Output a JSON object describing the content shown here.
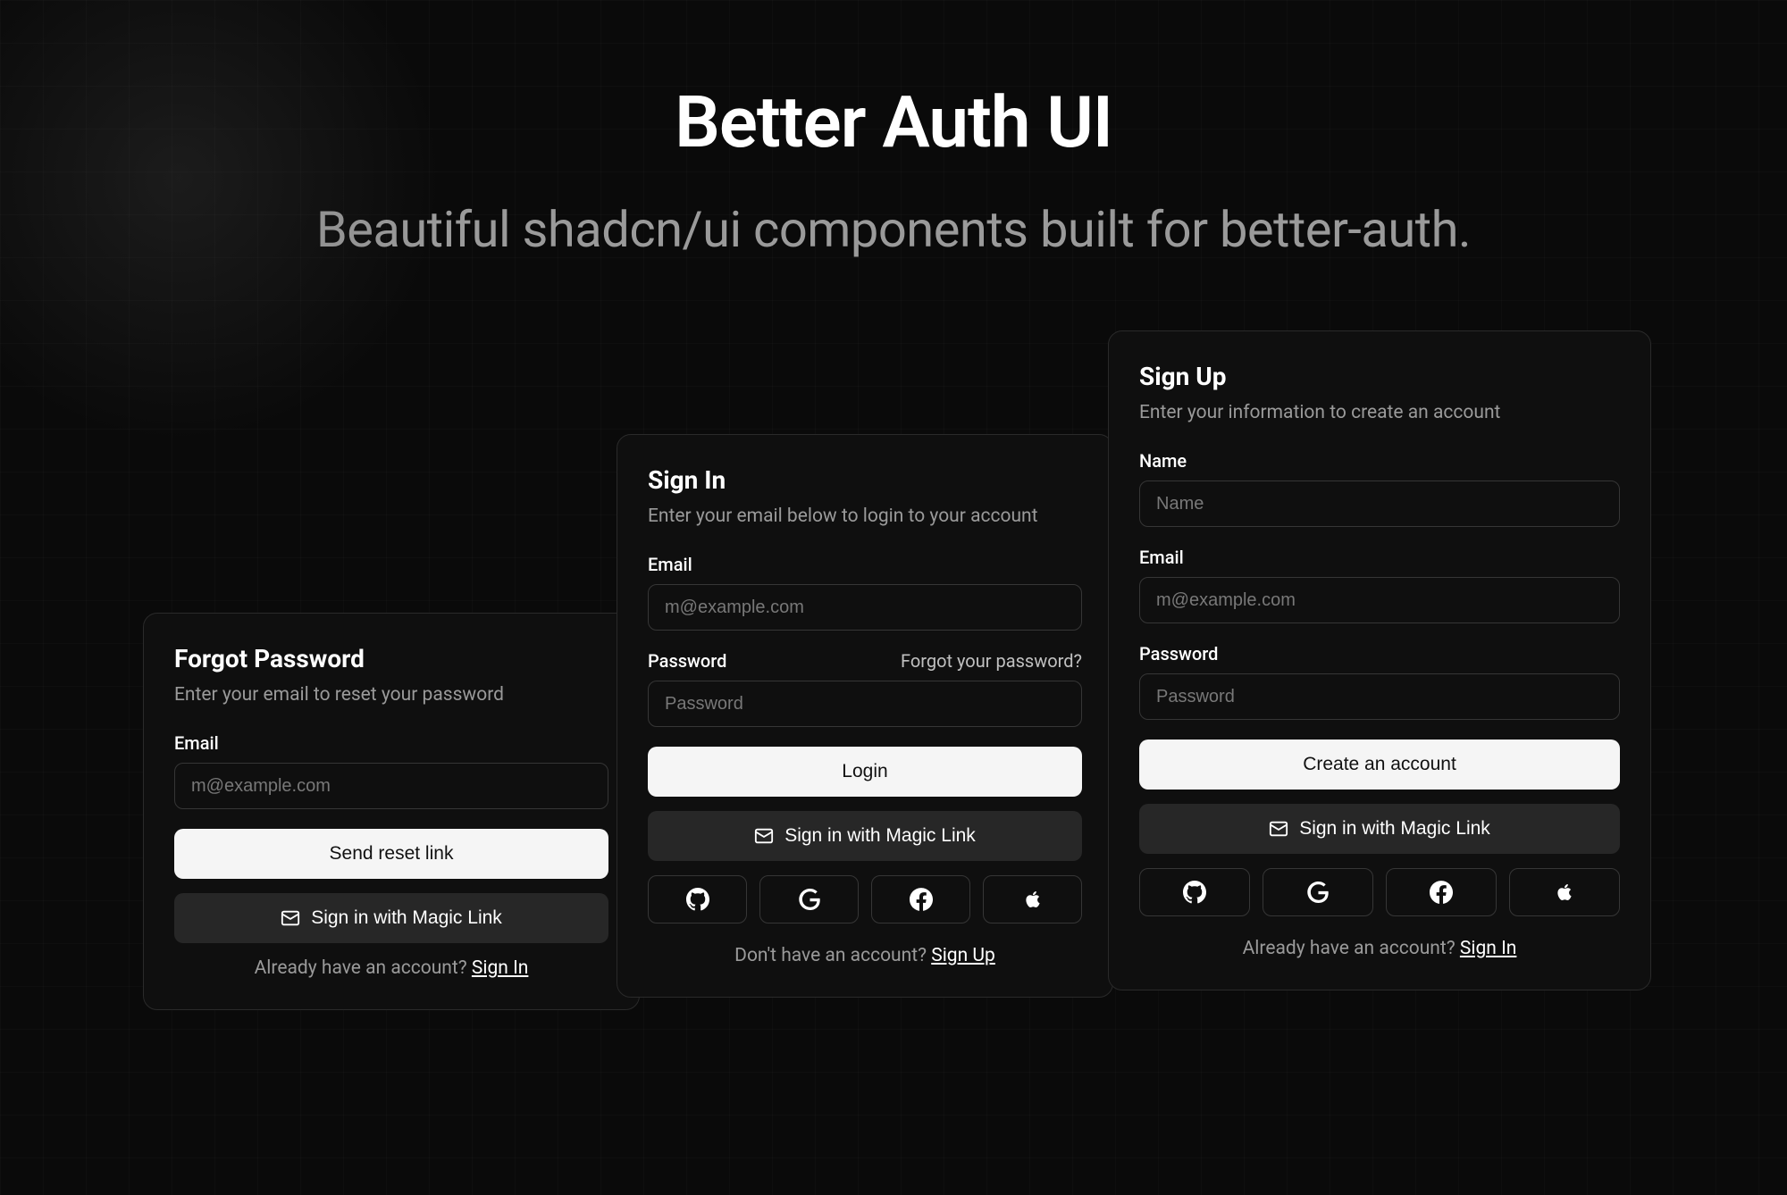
{
  "header": {
    "title": "Better Auth UI",
    "subtitle": "Beautiful shadcn/ui components built for better-auth."
  },
  "forgot": {
    "title": "Forgot Password",
    "subtitle": "Enter your email to reset your password",
    "email_label": "Email",
    "email_placeholder": "m@example.com",
    "submit_label": "Send reset link",
    "magic_link_label": "Sign in with Magic Link",
    "footer_text": "Already have an account? ",
    "footer_link": "Sign In"
  },
  "signin": {
    "title": "Sign In",
    "subtitle": "Enter your email below to login to your account",
    "email_label": "Email",
    "email_placeholder": "m@example.com",
    "password_label": "Password",
    "password_placeholder": "Password",
    "forgot_link": "Forgot your password?",
    "submit_label": "Login",
    "magic_link_label": "Sign in with Magic Link",
    "footer_text": "Don't have an account? ",
    "footer_link": "Sign Up"
  },
  "signup": {
    "title": "Sign Up",
    "subtitle": "Enter your information to create an account",
    "name_label": "Name",
    "name_placeholder": "Name",
    "email_label": "Email",
    "email_placeholder": "m@example.com",
    "password_label": "Password",
    "password_placeholder": "Password",
    "submit_label": "Create an account",
    "magic_link_label": "Sign in with Magic Link",
    "footer_text": "Already have an account? ",
    "footer_link": "Sign In"
  }
}
